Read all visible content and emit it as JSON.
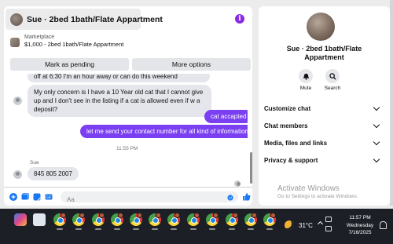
{
  "colors": {
    "accent": "#7b3ff2",
    "info": "#8a2be2",
    "taskbar": "#1c1f26",
    "like": "#1877f2"
  },
  "chat": {
    "title": "Sue · 2bed 1bath/Flate Appartment",
    "marketplace_label": "Marketplace",
    "listing": "$1,000 - 2bed 1bath/Flate Appartment",
    "buttons": {
      "pending": "Mark as pending",
      "more": "More options"
    },
    "messages": {
      "m1": "off at 6:30 I'm an hour away or can do this weekend",
      "m2": "My only concern is I have a 10 Year old cat that I cannot give up and I don't see in the listing if a cat is allowed even if w a deposit?",
      "m3": "cat accapted",
      "m4": "let me send your contact number for all kind of information",
      "time": "11:55 PM",
      "sender": "Sue",
      "m5": "845 805 2007"
    },
    "input_placeholder": "Aa"
  },
  "side": {
    "title": "Sue · 2bed 1bath/Flate Appartment",
    "actions": {
      "mute": "Mute",
      "search": "Search"
    },
    "sections": {
      "customize": "Customize chat",
      "members": "Chat members",
      "media": "Media, files and links",
      "privacy": "Privacy & support"
    },
    "watermark_title": "Activate Windows",
    "watermark_sub": "Go to Settings to activate Windows."
  },
  "taskbar": {
    "temperature": "31°C",
    "time": "11:57 PM",
    "day": "Wednesday",
    "date": "7/16/2025"
  }
}
